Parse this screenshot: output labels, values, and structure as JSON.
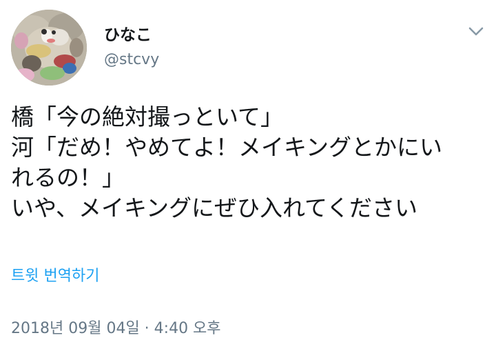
{
  "user": {
    "display_name": "ひなこ",
    "handle": "@stcvy"
  },
  "tweet": {
    "lines": [
      "橋「今の絶対撮っといて」",
      "河「だめ！やめてよ！メイキングとかにい",
      "れるの！」",
      "いや、メイキングにぜひ入れてください"
    ],
    "translate_label": "트윗 번역하기",
    "timestamp": "2018년 09월 04일 · 4:40 오후"
  },
  "icons": {
    "menu": "chevron-down-icon"
  },
  "colors": {
    "text": "#14171a",
    "secondary": "#657786",
    "link": "#1da1f2"
  }
}
